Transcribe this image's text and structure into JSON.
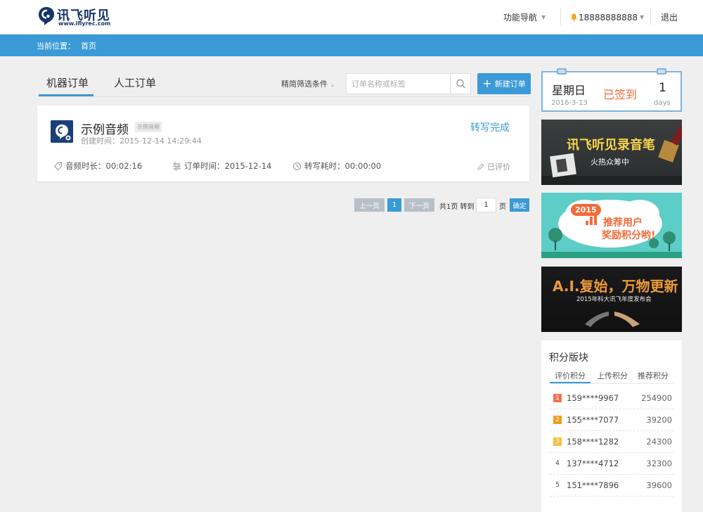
{
  "header": {
    "logo_cn": "讯飞听见",
    "logo_url": "www.iflyrec.com",
    "nav_label": "功能导航",
    "user_phone": "18888888888",
    "logout_label": "退出"
  },
  "breadcrumb": {
    "prefix": "当前位置：",
    "current": "首页"
  },
  "tabs": [
    {
      "label": "机器订单"
    },
    {
      "label": "人工订单"
    }
  ],
  "toolbar": {
    "filter_label": "精简筛选条件",
    "search_placeholder": "订单名称或标签",
    "new_order_label": "新建订单"
  },
  "order": {
    "title": "示例音频",
    "tag": "示例音频",
    "created": "创建时间：2015-12-14 14:29:44",
    "status": "转写完成",
    "duration": "音频时长：00:02:16",
    "order_time": "订单时间：2015-12-14",
    "transcribe_time": "转写耗时：00:00:00",
    "rated": "已评价"
  },
  "pagination": {
    "prev_label": "上一页",
    "current_page": "1",
    "next_label": "下一页",
    "total_text": "共1页 转到",
    "jump_value": "1",
    "page_unit": "页",
    "confirm_label": "确定"
  },
  "signin": {
    "weekday": "星期日",
    "date": "2016-3-13",
    "status": "已签到",
    "days": "1",
    "days_unit": "days"
  },
  "banners": {
    "b1_title": "讯飞听见录音笔",
    "b1_sub": "火热众筹中",
    "b2_year": "2015",
    "b2_line1": "推荐用户",
    "b2_line2": "奖励积分哟!",
    "b3_title": "A.I.复始，万物更新",
    "b3_sub": "2015年科大讯飞年度发布会"
  },
  "points": {
    "title": "积分版块",
    "tabs": [
      "评价积分",
      "上传积分",
      "推荐积分"
    ],
    "rows": [
      {
        "rank": "1",
        "name": "159****9967",
        "score": "254900"
      },
      {
        "rank": "2",
        "name": "155****7077",
        "score": "39200"
      },
      {
        "rank": "3",
        "name": "158****1282",
        "score": "24300"
      },
      {
        "rank": "4",
        "name": "137****4712",
        "score": "32300"
      },
      {
        "rank": "5",
        "name": "151****7896",
        "score": "39600"
      }
    ]
  },
  "colors": {
    "accent": "#3a9ad6",
    "brand_dark": "#15356b",
    "signin_status": "#f26b3a",
    "rank1": "#f4734f",
    "rank2": "#f49b1f",
    "rank3": "#f7c046"
  }
}
